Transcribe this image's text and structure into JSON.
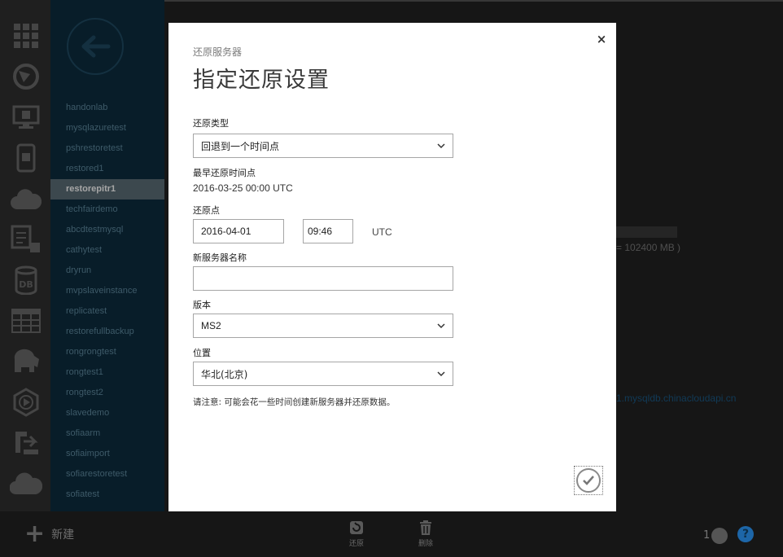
{
  "sidebar": {
    "items": [
      "handonlab",
      "mysqlazuretest",
      "pshrestoretest",
      "restored1",
      "restorepitr1",
      "techfairdemo",
      "abcdtestmysql",
      "cathytest",
      "dryrun",
      "mvpslaveinstance",
      "replicatest",
      "restorefullbackup",
      "rongrongtest",
      "rongtest1",
      "rongtest2",
      "slavedemo",
      "sofiaarm",
      "sofiaimport",
      "sofiarestoretest",
      "sofiatest"
    ],
    "active_index": 4
  },
  "main": {
    "size_text": "= 102400 MB )",
    "link_text": "1.mysqldb.chinacloudapi.cn"
  },
  "dialog": {
    "subtitle": "还原服务器",
    "title": "指定还原设置",
    "restore_type_label": "还原类型",
    "restore_type_value": "回退到一个时间点",
    "earliest_label": "最早还原时间点",
    "earliest_value": "2016-03-25 00:00 UTC",
    "restore_point_label": "还原点",
    "restore_date": "2016-04-01",
    "restore_time": "09:46",
    "tz": "UTC",
    "server_name_label": "新服务器名称",
    "server_name_value": "",
    "version_label": "版本",
    "version_value": "MS2",
    "location_label": "位置",
    "location_value": "华北(北京)",
    "note": "请注意: 可能会花一些时间创建新服务器并还原数据。",
    "close_glyph": "×"
  },
  "cmdbar": {
    "new_label": "新建",
    "restore_label": "还原",
    "delete_label": "删除",
    "count": "1",
    "help_glyph": "?"
  },
  "colors": {
    "accent": "#1d66a8",
    "sidebar_bg": "#0d2d3f",
    "active_item": "#5d6f78"
  },
  "icons": [
    "grid-icon",
    "globe-icon",
    "monitor-icon",
    "mobile-icon",
    "cloud-services-icon",
    "document-copy-icon",
    "db-icon",
    "table-icon",
    "elephant-icon",
    "media-icon",
    "deploy-icon",
    "cloud-icon",
    "back-arrow-icon",
    "restore-icon",
    "trash-icon",
    "wrench-icon",
    "help-icon",
    "checkmark-icon",
    "chevron-down-icon",
    "close-icon"
  ]
}
